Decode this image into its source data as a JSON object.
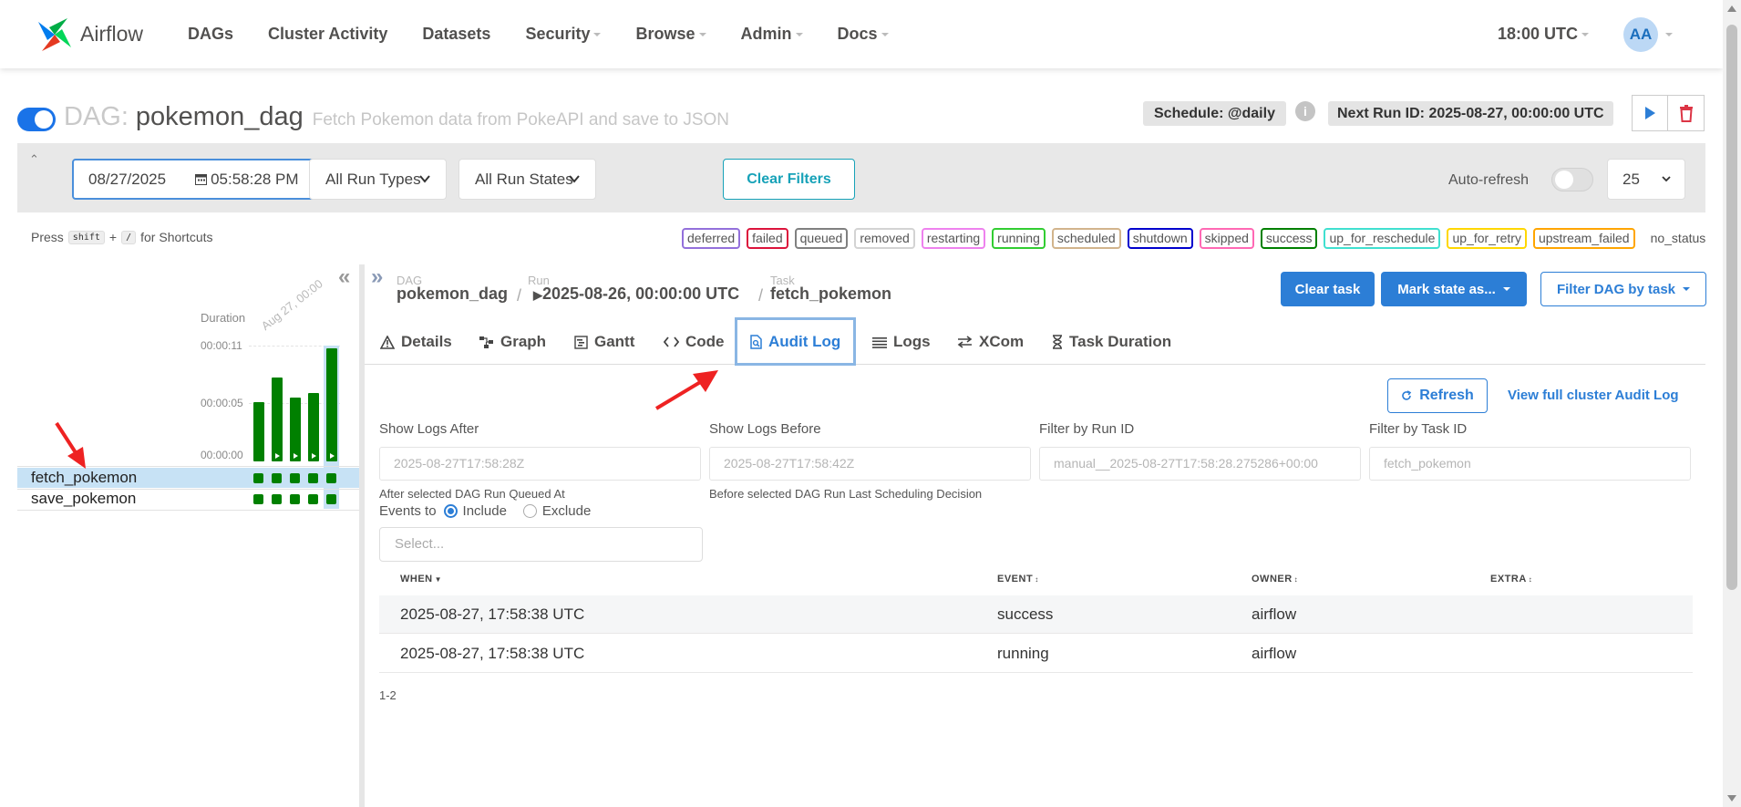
{
  "nav": {
    "brand": "Airflow",
    "links": [
      {
        "label": "DAGs",
        "dropdown": false
      },
      {
        "label": "Cluster Activity",
        "dropdown": false
      },
      {
        "label": "Datasets",
        "dropdown": false
      },
      {
        "label": "Security",
        "dropdown": true
      },
      {
        "label": "Browse",
        "dropdown": true
      },
      {
        "label": "Admin",
        "dropdown": true
      },
      {
        "label": "Docs",
        "dropdown": true
      }
    ],
    "time": "18:00 UTC",
    "avatar": "AA"
  },
  "dag": {
    "prefix": "DAG:",
    "id": "pokemon_dag",
    "description": "Fetch Pokemon data from PokeAPI and save to JSON",
    "schedule": "Schedule: @daily",
    "next_run": "Next Run ID: 2025-08-27, 00:00:00 UTC"
  },
  "filters": {
    "date": "08/27/2025",
    "time": "05:58:28  PM",
    "run_types": "All Run Types",
    "run_states": "All Run States",
    "clear_label": "Clear Filters",
    "auto_refresh": "Auto-refresh",
    "page_size": "25"
  },
  "shortcuts": {
    "press": "Press",
    "key1": "shift",
    "plus": "+",
    "key2": "/",
    "suffix": "for Shortcuts"
  },
  "legend": [
    {
      "label": "deferred",
      "color": "#9370db"
    },
    {
      "label": "failed",
      "color": "#dc143c"
    },
    {
      "label": "queued",
      "color": "#808080"
    },
    {
      "label": "removed",
      "color": "#d3d3d3"
    },
    {
      "label": "restarting",
      "color": "#ee82ee"
    },
    {
      "label": "running",
      "color": "#32cd32"
    },
    {
      "label": "scheduled",
      "color": "#d2b48c"
    },
    {
      "label": "shutdown",
      "color": "#0000cd"
    },
    {
      "label": "skipped",
      "color": "#ff69b4"
    },
    {
      "label": "success",
      "color": "#008000"
    },
    {
      "label": "up_for_reschedule",
      "color": "#40e0d0"
    },
    {
      "label": "up_for_retry",
      "color": "#ffd700"
    },
    {
      "label": "upstream_failed",
      "color": "#ffa500"
    }
  ],
  "legend_nostatus": "no_status",
  "grid": {
    "duration_label": "Duration",
    "axis": [
      "00:00:11",
      "00:00:05",
      "00:00:00"
    ],
    "run_label": "Aug 27, 00:00",
    "durations_s": [
      6.0,
      8.5,
      6.5,
      7.0,
      11.5
    ],
    "tasks": [
      "fetch_pokemon",
      "save_pokemon"
    ]
  },
  "breadcrumb": {
    "dag_label": "DAG",
    "dag_value": "pokemon_dag",
    "run_label": "Run",
    "run_value": "2025-08-26, 00:00:00 UTC",
    "task_label": "Task",
    "task_value": "fetch_pokemon",
    "sep": "/"
  },
  "actions": {
    "clear_task": "Clear task",
    "mark_state": "Mark state as...",
    "filter_dag": "Filter DAG by task"
  },
  "tabs": [
    "Details",
    "Graph",
    "Gantt",
    "Code",
    "Audit Log",
    "Logs",
    "XCom",
    "Task Duration"
  ],
  "audit": {
    "refresh": "Refresh",
    "full_link": "View full cluster Audit Log",
    "labels": [
      "Show Logs After",
      "Show Logs Before",
      "Filter by Run ID",
      "Filter by Task ID"
    ],
    "placeholders": [
      "2025-08-27T17:58:28Z",
      "2025-08-27T17:58:42Z",
      "manual__2025-08-27T17:58:28.275286+00:00",
      "fetch_pokemon"
    ],
    "hint_after": "After selected DAG Run Queued At",
    "hint_before": "Before selected DAG Run Last Scheduling Decision",
    "events_to": "Events to",
    "include": "Include",
    "exclude": "Exclude",
    "select_placeholder": "Select...",
    "columns": [
      "WHEN",
      "EVENT",
      "OWNER",
      "EXTRA"
    ],
    "rows": [
      {
        "when": "2025-08-27, 17:58:38 UTC",
        "event": "success",
        "owner": "airflow",
        "extra": ""
      },
      {
        "when": "2025-08-27, 17:58:38 UTC",
        "event": "running",
        "owner": "airflow",
        "extra": ""
      }
    ],
    "count": "1-2"
  }
}
